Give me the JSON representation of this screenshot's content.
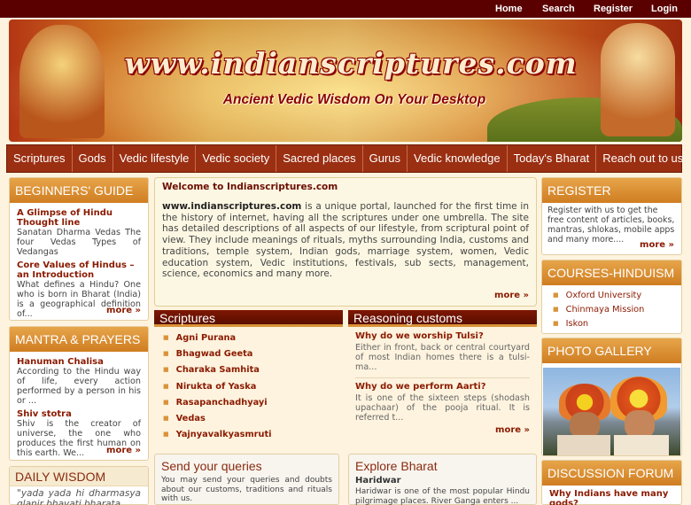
{
  "topnav": {
    "home": "Home",
    "search": "Search",
    "register": "Register",
    "login": "Login"
  },
  "banner": {
    "logo_text": "www.indianscriptures.com",
    "tagline": "Ancient Vedic Wisdom On Your Desktop"
  },
  "nav": [
    "Scriptures",
    "Gods",
    "Vedic lifestyle",
    "Vedic society",
    "Sacred places",
    "Gurus",
    "Vedic knowledge",
    "Today's Bharat",
    "Reach out to us"
  ],
  "beginners": {
    "title": "BEGINNERS' GUIDE",
    "items": [
      {
        "title": "A Glimpse of Hindu Thought line",
        "text": "Sanatan Dharma Vedas The four Vedas Types of Vedangas"
      },
      {
        "title": "Core Values of Hindus – an Introduction",
        "text": "What defines a Hindu? One who is born in Bharat (India) is a geographical definition of..."
      }
    ],
    "more": "more »"
  },
  "mantra": {
    "title": "MANTRA & PRAYERS",
    "items": [
      {
        "title": "Hanuman Chalisa",
        "text": "According to the Hindu way of life, every action performed by a person in his or ..."
      },
      {
        "title": "Shiv stotra",
        "text": "Shiv is the creator of universe, the one who produces the first human on this earth. We..."
      }
    ],
    "more": "more »"
  },
  "daily": {
    "title": "DAILY WISDOM",
    "quote": "\"yada yada hi dharmasya glanir bhavati bharata"
  },
  "welcome": {
    "heading": "Welcome to Indianscriptures.com",
    "site": "www.indianscriptures.com",
    "body": " is a unique portal, launched for the first time in the history of internet, having all the scriptures under one umbrella. The site has detailed descriptions of all aspects of our lifestyle, from scriptural point of view. They include meanings of rituals, myths surrounding India, customs and traditions, temple system, Indian gods, marriage system, women, Vedic education system, Vedic institutions, festivals, sub sects, management, science, economics and many more.",
    "more": "more »"
  },
  "scriptures": {
    "title": "Scriptures",
    "items": [
      "Agni Purana",
      "Bhagwad Geeta",
      "Charaka Samhita",
      "Nirukta of Yaska",
      "Rasapanchadhyayi",
      "Vedas",
      "Yajnyavalkyasmruti"
    ]
  },
  "reasoning": {
    "title": "Reasoning customs",
    "items": [
      {
        "title": "Why do we worship Tulsi?",
        "text": "Either in front, back or central courtyard of most Indian homes there is a tulsi-ma..."
      },
      {
        "title": "Why do we perform Aarti?",
        "text": "It is one of the sixteen steps (shodash upachaar) of the pooja ritual. It is referred t..."
      }
    ],
    "more": "more »"
  },
  "queries": {
    "title": "Send your queries",
    "text": "You may send your queries and doubts about our customs, traditions and rituals with us."
  },
  "explore": {
    "title": "Explore Bharat",
    "item": "Haridwar",
    "text": "Haridwar is one of the most popular Hindu pilgrimage places. River Ganga enters ..."
  },
  "register": {
    "title": "REGISTER",
    "text": "Register with us to get the free content of articles, books, mantras, shlokas, mobile apps and many more....",
    "more": "more »"
  },
  "courses": {
    "title": "COURSES-HINDUISM",
    "items": [
      "Oxford University",
      "Chinmaya Mission",
      "Iskon"
    ]
  },
  "gallery": {
    "title": "PHOTO GALLERY"
  },
  "forum": {
    "title": "DISCUSSION FORUM",
    "item": "Why Indians have many gods?"
  }
}
